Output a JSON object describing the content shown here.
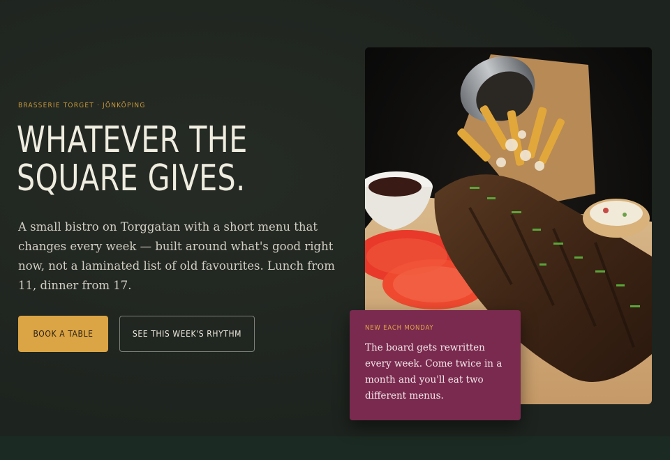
{
  "hero": {
    "eyebrow": "BRASSERIE TORGET · JÖNKÖPING",
    "headline": "WHATEVER THE SQUARE GIVES.",
    "lead": "A small bistro on Torggatan with a short menu that changes every week — built around what's good right now, not a laminated list of old favourites. Lunch from 11, dinner from 17.",
    "primary_button": "BOOK A TABLE",
    "secondary_button": "SEE THIS WEEK'S RHYTHM"
  },
  "note": {
    "eyebrow": "NEW EACH MONDAY",
    "body": "The board gets rewritten every week. Come twice in a month and you'll eat two different menus."
  },
  "colors": {
    "background": "#1f2620",
    "accent_gold": "#dba444",
    "headline": "#efece0",
    "note_card": "#7a2a4e"
  },
  "photo": {
    "description_icon": "food-photo-ribs-fries"
  }
}
